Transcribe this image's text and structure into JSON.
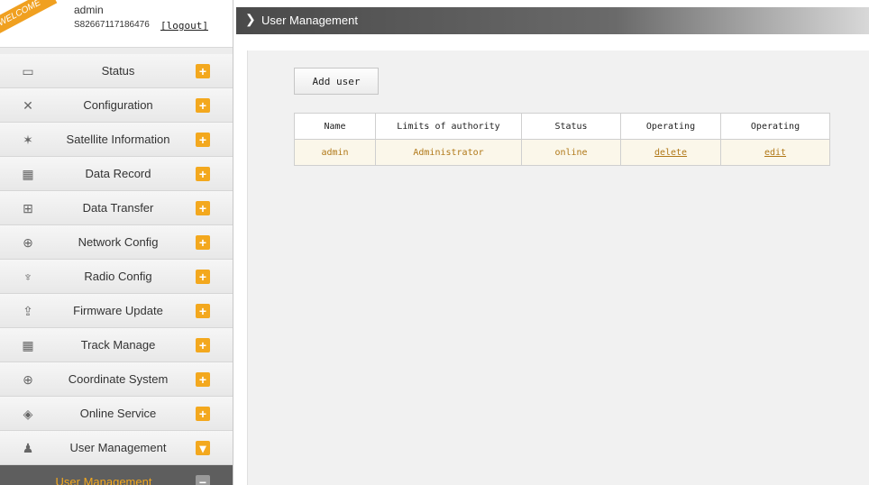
{
  "header": {
    "welcome": "WELCOME",
    "username": "admin",
    "serial": "S82667117186476",
    "logout": "[logout]"
  },
  "sidebar": {
    "items": [
      {
        "label": "Status",
        "icon": "monitor-icon",
        "glyph": "▭",
        "toggle": "+"
      },
      {
        "label": "Configuration",
        "icon": "tools-icon",
        "glyph": "✕",
        "toggle": "+"
      },
      {
        "label": "Satellite Information",
        "icon": "satellite-icon",
        "glyph": "✶",
        "toggle": "+"
      },
      {
        "label": "Data Record",
        "icon": "calendar-icon",
        "glyph": "▦",
        "toggle": "+"
      },
      {
        "label": "Data Transfer",
        "icon": "network-icon",
        "glyph": "⊞",
        "toggle": "+"
      },
      {
        "label": "Network Config",
        "icon": "globe-icon",
        "glyph": "⊕",
        "toggle": "+"
      },
      {
        "label": "Radio Config",
        "icon": "antenna-icon",
        "glyph": "♆",
        "toggle": "+"
      },
      {
        "label": "Firmware Update",
        "icon": "upload-icon",
        "glyph": "⇪",
        "toggle": "+"
      },
      {
        "label": "Track Manage",
        "icon": "calendar-icon",
        "glyph": "▦",
        "toggle": "+"
      },
      {
        "label": "Coordinate System",
        "icon": "globe-icon",
        "glyph": "⊕",
        "toggle": "+"
      },
      {
        "label": "Online Service",
        "icon": "cube-icon",
        "glyph": "◈",
        "toggle": "+"
      },
      {
        "label": "User Management",
        "icon": "users-icon",
        "glyph": "♟",
        "toggle": "▾"
      }
    ],
    "active": {
      "label": "User Management",
      "toggle": "−"
    }
  },
  "main": {
    "title": "User Management",
    "add_label": "Add user",
    "table": {
      "headers": [
        "Name",
        "Limits of authority",
        "Status",
        "Operating",
        "Operating"
      ],
      "rows": [
        {
          "name": "admin",
          "authority": "Administrator",
          "status": "online",
          "op1": "delete",
          "op2": "edit"
        }
      ]
    }
  },
  "colors": {
    "accent": "#f3a81e",
    "link": "#b07818",
    "active_bg": "#5e5e5e"
  }
}
